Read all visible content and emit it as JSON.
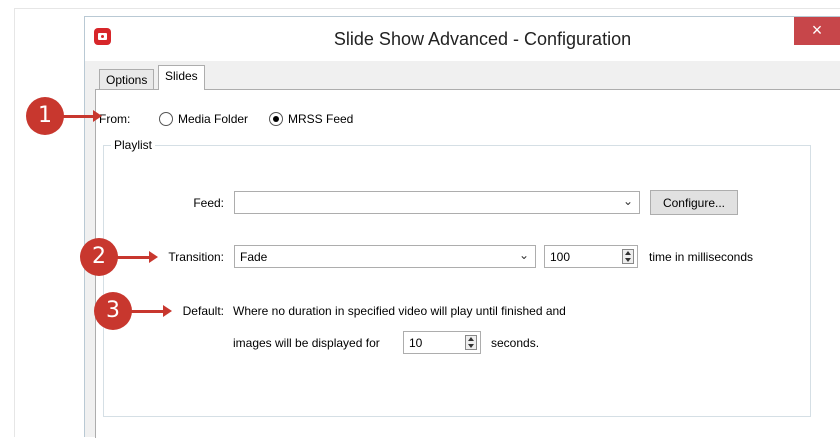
{
  "window": {
    "title": "Slide Show Advanced - Configuration",
    "close_symbol": "×",
    "app_icon": "app-logo-icon"
  },
  "tabs": [
    {
      "label": "Options",
      "active": false
    },
    {
      "label": "Slides",
      "active": true
    }
  ],
  "from": {
    "label": "From:",
    "options": [
      {
        "label": "Media Folder",
        "checked": false
      },
      {
        "label": "MRSS Feed",
        "checked": true
      }
    ]
  },
  "playlist": {
    "group_title": "Playlist",
    "feed": {
      "label": "Feed:",
      "value": "",
      "configure_label": "Configure..."
    },
    "transition": {
      "label": "Transition:",
      "value": "Fade",
      "time_value": "100",
      "time_suffix": "time in milliseconds"
    },
    "default": {
      "label": "Default:",
      "line1": "Where no duration in specified video will play until finished and",
      "line2_prefix": "images will be displayed for",
      "seconds_value": "10",
      "line2_suffix": "seconds."
    }
  },
  "callouts": [
    "1",
    "2",
    "3"
  ],
  "colors": {
    "callout": "#c8372e",
    "close": "#c7464a",
    "app_icon": "#d7262a"
  }
}
